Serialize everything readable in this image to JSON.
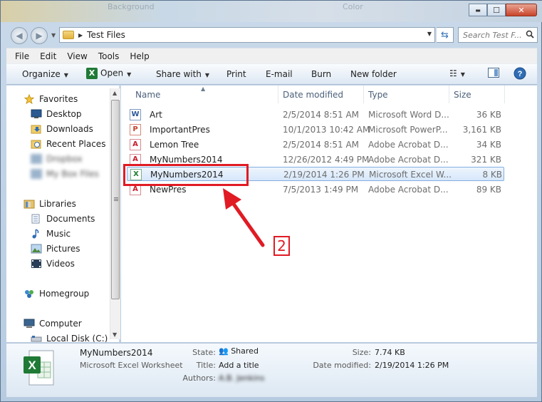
{
  "window": {
    "ghost_left": "Background",
    "ghost_right": "Color"
  },
  "caption": {
    "minimize": "▬",
    "maximize": "☐",
    "close": "✕"
  },
  "address": {
    "path": "Test Files",
    "search_placeholder": "Search Test F..."
  },
  "menu": [
    "File",
    "Edit",
    "View",
    "Tools",
    "Help"
  ],
  "toolbar": {
    "organize": "Organize",
    "open": "Open",
    "share_with": "Share with",
    "print": "Print",
    "email": "E-mail",
    "burn": "Burn",
    "new_folder": "New folder"
  },
  "navigation": {
    "favorites": "Favorites",
    "desktop": "Desktop",
    "downloads": "Downloads",
    "recent_places": "Recent Places",
    "blurred1": "Dropbox",
    "blurred2": "My Box Files",
    "libraries": "Libraries",
    "documents": "Documents",
    "music": "Music",
    "pictures": "Pictures",
    "videos": "Videos",
    "homegroup": "Homegroup",
    "computer": "Computer",
    "local_disk": "Local Disk (C:)"
  },
  "columns": {
    "name": "Name",
    "date": "Date modified",
    "type": "Type",
    "size": "Size"
  },
  "files": [
    {
      "name": "Art",
      "date": "2/5/2014 8:51 AM",
      "type": "Microsoft Word D...",
      "size": "36 KB",
      "icon": "word-doc-icon"
    },
    {
      "name": "ImportantPres",
      "date": "10/1/2013 10:42 AM",
      "type": "Microsoft PowerP...",
      "size": "3,161 KB",
      "icon": "powerpoint-icon"
    },
    {
      "name": "Lemon Tree",
      "date": "2/5/2014 8:51 AM",
      "type": "Adobe Acrobat D...",
      "size": "34 KB",
      "icon": "pdf-icon"
    },
    {
      "name": "MyNumbers2014",
      "date": "12/26/2012 4:49 PM",
      "type": "Adobe Acrobat D...",
      "size": "321 KB",
      "icon": "pdf-icon"
    },
    {
      "name": "MyNumbers2014",
      "date": "2/19/2014 1:26 PM",
      "type": "Microsoft Excel W...",
      "size": "8 KB",
      "icon": "excel-icon",
      "selected": true
    },
    {
      "name": "NewPres",
      "date": "7/5/2013 1:49 PM",
      "type": "Adobe Acrobat D...",
      "size": "89 KB",
      "icon": "pdf-icon"
    }
  ],
  "annotation": {
    "step": "2",
    "color": "#e01b24"
  },
  "details": {
    "name": "MyNumbers2014",
    "type": "Microsoft Excel Worksheet",
    "state_label": "State:",
    "state_value": "Shared",
    "title_label": "Title:",
    "title_value": "Add a title",
    "authors_label": "Authors:",
    "authors_value": "A.B. Jenkins",
    "size_label": "Size:",
    "size_value": "7.74 KB",
    "date_label": "Date modified:",
    "date_value": "2/19/2014 1:26 PM"
  }
}
